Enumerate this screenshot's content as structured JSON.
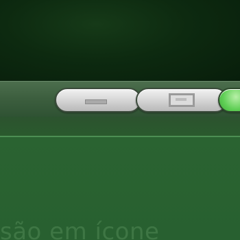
{
  "window": {
    "controls": {
      "minimize_icon": "minimize-icon",
      "maximize_icon": "maximize-icon",
      "close_icon": "close-icon"
    }
  },
  "content": {
    "partial_text": "são em ícone"
  },
  "colors": {
    "desktop": "#0d2a10",
    "titlebar": "#3d5f3f",
    "content": "#286030",
    "close_button": "#5fcf55"
  }
}
